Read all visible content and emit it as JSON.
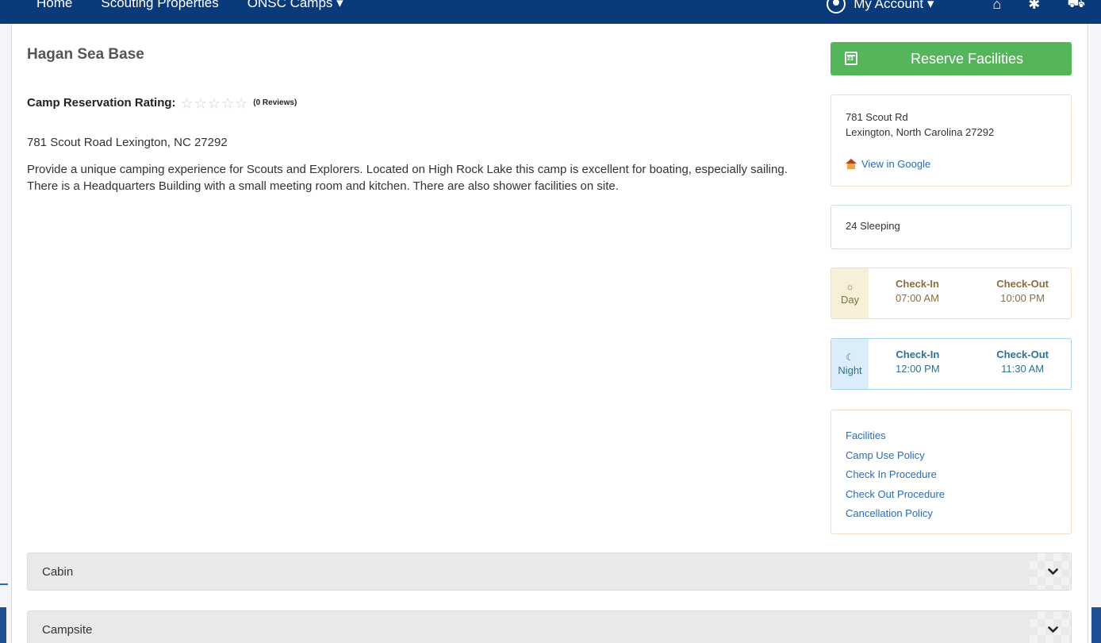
{
  "navbar": {
    "items": [
      "Home",
      "Scouting Properties",
      "ONSC Camps ▾"
    ],
    "account_label": "My Account ▾"
  },
  "camp": {
    "title": "Hagan Sea Base",
    "rating_label": "Camp Reservation Rating:",
    "rating_stars": 0,
    "reviews_text": "(0 Reviews)",
    "address": "781 Scout Road Lexington, NC 27292",
    "description": "Provide a unique camping experience for Scouts and Explorers. Located on High Rock Lake this camp is excellent for boating, especially sailing. There is a Headquarters Building with a small meeting room and kitchen.  There are also shower facilities on site."
  },
  "sidebar": {
    "reserve_label": "Reserve Facilities",
    "address_line1": "781 Scout Rd",
    "address_line2": "Lexington, North Carolina 27292",
    "google_link": "View in Google",
    "sleeping": "24  Sleeping",
    "day": {
      "label": "Day",
      "checkin_header": "Check-In",
      "checkin_time": "07:00 AM",
      "checkout_header": "Check-Out",
      "checkout_time": "10:00 PM"
    },
    "night": {
      "label": "Night",
      "checkin_header": "Check-In",
      "checkin_time": "12:00 PM",
      "checkout_header": "Check-Out",
      "checkout_time": "11:30 AM"
    },
    "links": [
      "Facilities",
      "Camp Use Policy",
      "Check In Procedure",
      "Check Out Procedure",
      "Cancellation Policy"
    ]
  },
  "accordions": [
    "Cabin",
    "Campsite"
  ],
  "colors": {
    "navbar": "#0b3a7a",
    "reserve_button": "#55b55a",
    "link": "#2a6bb5",
    "day_accent": "#8a6d3b",
    "night_accent": "#31708f"
  }
}
